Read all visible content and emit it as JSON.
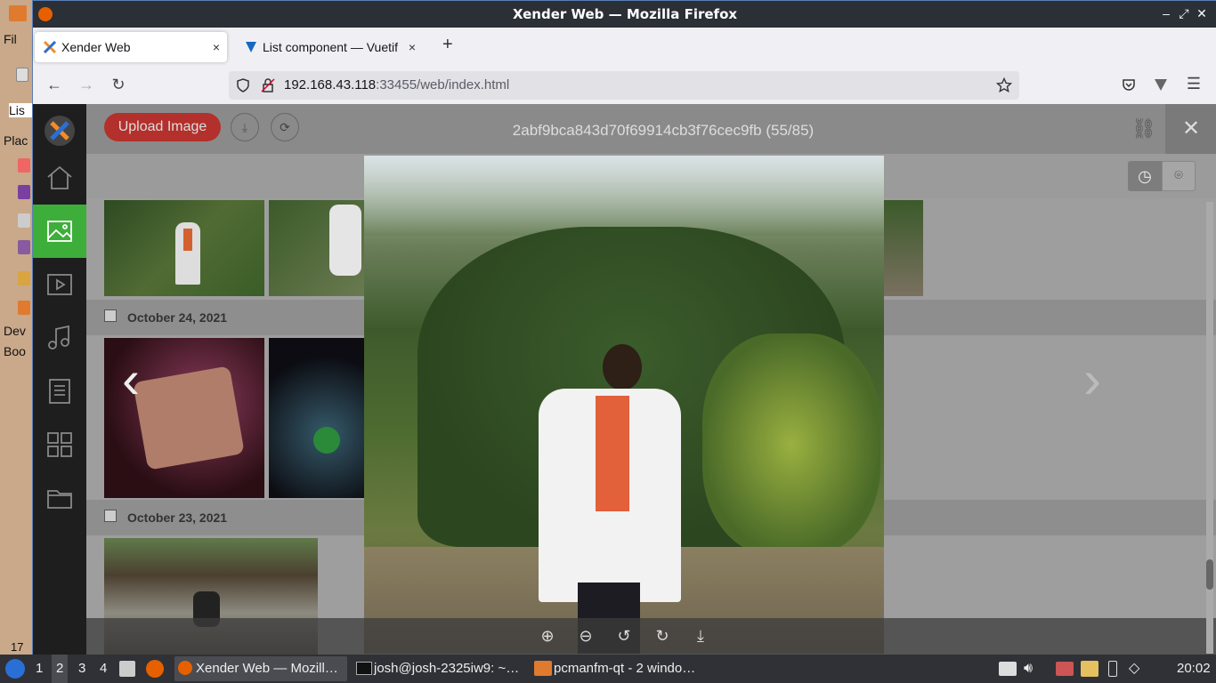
{
  "desktop": {
    "labels": [
      "Fil",
      "Lis",
      "Plac",
      "Dev",
      "Boo",
      "17"
    ]
  },
  "window": {
    "title": "Xender Web — Mozilla Firefox"
  },
  "tabs": [
    {
      "label": "Xender Web",
      "close": "×"
    },
    {
      "label": "List component — Vuetif",
      "close": "×"
    }
  ],
  "new_tab": "+",
  "url": {
    "host": "192.168.43.118",
    "rest": ":33455/web/index.html"
  },
  "app": {
    "upload_label": "Upload Image",
    "groups": [
      {
        "date": "October 24, 2021"
      },
      {
        "date": "October 23, 2021"
      }
    ],
    "viewer_title": "2abf9bca843d70f69914cb3f76cec9fb (55/85)",
    "sidebar": [
      "home",
      "images",
      "videos",
      "music",
      "documents",
      "apps",
      "folders"
    ]
  },
  "taskbar": {
    "workspaces": [
      "1",
      "2",
      "3",
      "4"
    ],
    "apps": [
      {
        "label": "Xender Web — Mozill…"
      },
      {
        "label": "josh@josh-2325iw9: ~…"
      },
      {
        "label": "pcmanfm-qt - 2 windo…"
      }
    ],
    "clock": "20:02"
  }
}
